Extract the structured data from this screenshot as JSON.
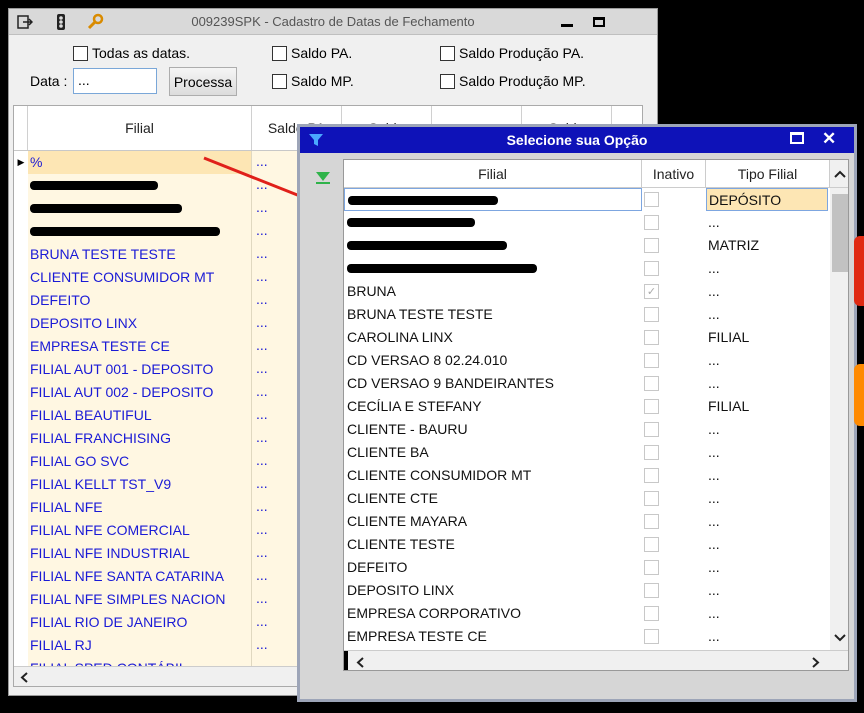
{
  "main": {
    "title": "009239SPK - Cadastro de Datas de Fechamento",
    "toolbar_icons": [
      "export-icon",
      "traffic-light-icon",
      "wrench-icon"
    ],
    "checks": {
      "todas": "Todas as datas.",
      "saldo_pa": "Saldo PA.",
      "saldo_mp": "Saldo MP.",
      "saldo_prod_pa": "Saldo Produção PA.",
      "saldo_prod_mp": "Saldo Produção MP."
    },
    "data_label": "Data :",
    "data_value": "...",
    "processa": "Processa",
    "grid": {
      "headers": [
        "Filial",
        "Saldo PA",
        "Saldo MP",
        "Saldo"
      ],
      "headers_top": [
        "",
        "",
        "Saldo",
        "Saldo"
      ],
      "rows": [
        {
          "filial": "%",
          "saldo": "..."
        },
        {
          "filial": "",
          "saldo": "..."
        },
        {
          "filial": "",
          "saldo": "..."
        },
        {
          "filial": "",
          "saldo": "..."
        },
        {
          "filial": "BRUNA TESTE TESTE",
          "saldo": "..."
        },
        {
          "filial": "CLIENTE CONSUMIDOR MT",
          "saldo": "..."
        },
        {
          "filial": "DEFEITO",
          "saldo": "..."
        },
        {
          "filial": "DEPOSITO LINX",
          "saldo": "..."
        },
        {
          "filial": "EMPRESA TESTE CE",
          "saldo": "..."
        },
        {
          "filial": "FILIAL AUT 001 - DEPOSITO",
          "saldo": "..."
        },
        {
          "filial": "FILIAL AUT 002 - DEPOSITO",
          "saldo": "..."
        },
        {
          "filial": "FILIAL BEAUTIFUL",
          "saldo": "..."
        },
        {
          "filial": "FILIAL FRANCHISING",
          "saldo": "..."
        },
        {
          "filial": "FILIAL GO SVC",
          "saldo": "..."
        },
        {
          "filial": "FILIAL KELLT TST_V9",
          "saldo": "..."
        },
        {
          "filial": "FILIAL NFE",
          "saldo": "..."
        },
        {
          "filial": "FILIAL NFE COMERCIAL",
          "saldo": "..."
        },
        {
          "filial": "FILIAL NFE INDUSTRIAL",
          "saldo": "..."
        },
        {
          "filial": "FILIAL NFE SANTA CATARINA",
          "saldo": "..."
        },
        {
          "filial": "FILIAL NFE SIMPLES NACION",
          "saldo": "..."
        },
        {
          "filial": "FILIAL RIO DE JANEIRO",
          "saldo": "..."
        },
        {
          "filial": "FILIAL RJ",
          "saldo": "..."
        },
        {
          "filial": "FILIAL SPED CONTÁBIL",
          "saldo": "..."
        }
      ]
    }
  },
  "dialog": {
    "title": "Selecione sua Opção",
    "headers": [
      "Filial",
      "Inativo",
      "Tipo Filial"
    ],
    "rows": [
      {
        "filial": "",
        "inativo": false,
        "tipo": "DEPÓSITO"
      },
      {
        "filial": "",
        "inativo": false,
        "tipo": "..."
      },
      {
        "filial": "",
        "inativo": false,
        "tipo": "MATRIZ"
      },
      {
        "filial": "",
        "inativo": false,
        "tipo": "..."
      },
      {
        "filial": "BRUNA",
        "inativo": true,
        "tipo": "..."
      },
      {
        "filial": "BRUNA TESTE TESTE",
        "inativo": false,
        "tipo": "..."
      },
      {
        "filial": "CAROLINA LINX",
        "inativo": false,
        "tipo": "FILIAL"
      },
      {
        "filial": "CD VERSAO 8 02.24.010",
        "inativo": false,
        "tipo": "..."
      },
      {
        "filial": "CD VERSAO 9 BANDEIRANTES",
        "inativo": false,
        "tipo": "..."
      },
      {
        "filial": "CECÍLIA E STEFANY",
        "inativo": false,
        "tipo": "FILIAL"
      },
      {
        "filial": "CLIENTE - BAURU",
        "inativo": false,
        "tipo": "..."
      },
      {
        "filial": "CLIENTE BA",
        "inativo": false,
        "tipo": "..."
      },
      {
        "filial": "CLIENTE CONSUMIDOR MT",
        "inativo": false,
        "tipo": "..."
      },
      {
        "filial": "CLIENTE CTE",
        "inativo": false,
        "tipo": "..."
      },
      {
        "filial": "CLIENTE MAYARA",
        "inativo": false,
        "tipo": "..."
      },
      {
        "filial": "CLIENTE TESTE",
        "inativo": false,
        "tipo": "..."
      },
      {
        "filial": "DEFEITO",
        "inativo": false,
        "tipo": "..."
      },
      {
        "filial": "DEPOSITO LINX",
        "inativo": false,
        "tipo": "..."
      },
      {
        "filial": "EMPRESA CORPORATIVO",
        "inativo": false,
        "tipo": "..."
      },
      {
        "filial": "EMPRESA TESTE CE",
        "inativo": false,
        "tipo": "..."
      }
    ]
  },
  "colors": {
    "dialog_title_bg": "#0e12b8",
    "link_blue": "#1a1ad6",
    "row_bg": "#fff7e2",
    "selected_bg": "#fde6b4",
    "arrow": "#e0201a"
  }
}
